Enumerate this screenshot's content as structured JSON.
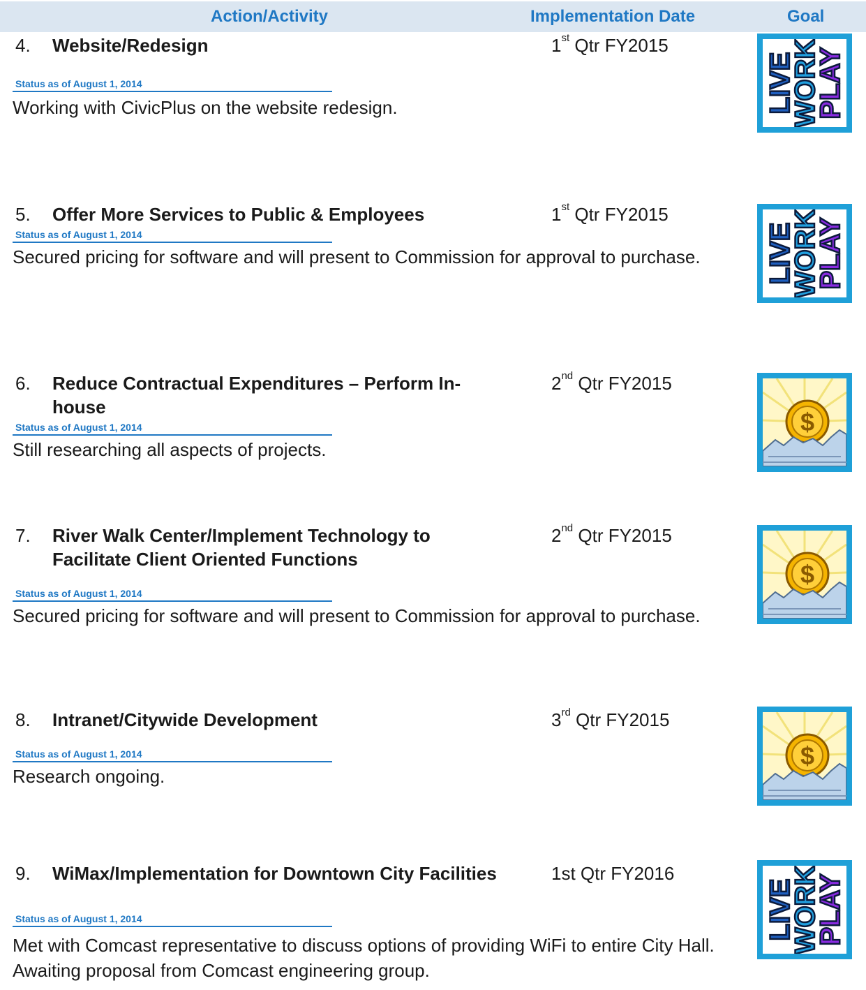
{
  "header": {
    "action": "Action/Activity",
    "implementation": "Implementation Date",
    "goal": "Goal"
  },
  "items": [
    {
      "number": "4.",
      "title": "Website/Redesign",
      "date_base": "1",
      "date_sup": "st",
      "date_rest": " Qtr FY2015",
      "status_label": "Status as of August 1, 2014",
      "status_text": "Working with CivicPlus on the website redesign.",
      "goal_icon": "live-work-play-icon",
      "goal_icon_text": [
        "LIVE",
        "WORK",
        "PLAY"
      ]
    },
    {
      "number": "5.",
      "title": "Offer More Services to Public & Employees",
      "date_base": "1",
      "date_sup": "st",
      "date_rest": " Qtr FY2015",
      "status_label": "Status as of August 1, 2014",
      "status_text": "Secured pricing for software and will present to Commission for approval to purchase.",
      "goal_icon": "live-work-play-icon",
      "goal_icon_text": [
        "LIVE",
        "WORK",
        "PLAY"
      ]
    },
    {
      "number": "6.",
      "title": "Reduce Contractual Expenditures – Perform In-house",
      "date_base": "2",
      "date_sup": "nd",
      "date_rest": " Qtr FY2015",
      "status_label": "Status as of August 1, 2014",
      "status_text": "Still researching all aspects of projects.",
      "goal_icon": "money-sun-icon"
    },
    {
      "number": "7.",
      "title": "River Walk Center/Implement Technology to Facilitate Client Oriented Functions",
      "date_base": "2",
      "date_sup": "nd",
      "date_rest": " Qtr FY2015",
      "status_label": "Status as of August 1, 2014",
      "status_text": "Secured pricing for software and will present to Commission for approval to purchase.",
      "goal_icon": "money-sun-icon"
    },
    {
      "number": "8.",
      "title": "Intranet/Citywide Development",
      "date_base": "3",
      "date_sup": "rd",
      "date_rest": " Qtr FY2015",
      "status_label": "Status as of August 1, 2014",
      "status_text": "Research ongoing.",
      "goal_icon": "money-sun-icon"
    },
    {
      "number": "9.",
      "title": "WiMax/Implementation for Downtown City Facilities",
      "date_base": "1st Qtr FY2016",
      "date_sup": "",
      "date_rest": "",
      "status_label": "Status as of August 1, 2014",
      "status_text": "Met with Comcast representative to discuss options of providing WiFi to entire City Hall.  Awaiting proposal from Comcast engineering group.",
      "goal_icon": "live-work-play-icon",
      "goal_icon_text": [
        "LIVE",
        "WORK",
        "PLAY"
      ]
    }
  ]
}
